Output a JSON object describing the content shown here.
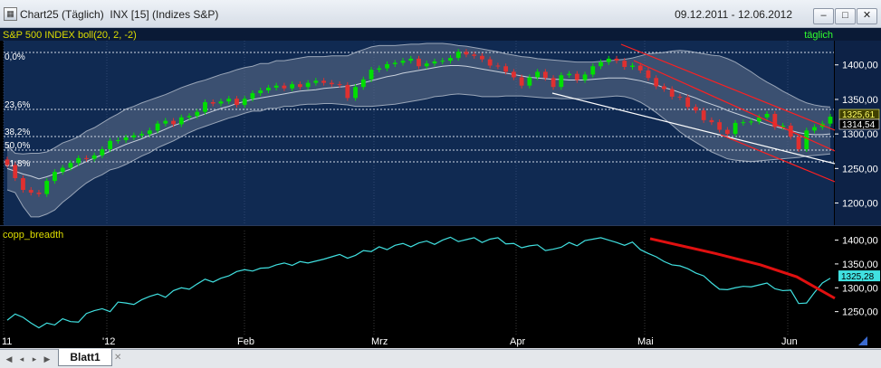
{
  "window": {
    "title": "Chart25 (Täglich)  INX [15] (Indizes S&P)",
    "date_range": "09.12.2011 - 12.06.2012",
    "buttons": {
      "minimize": "–",
      "maximize": "□",
      "close": "✕"
    }
  },
  "upper_panel": {
    "label": "S&P 500 INDEX boll(20, 2, -2)",
    "period_label": "täglich",
    "fib_levels": [
      "0,0%",
      "23,6%",
      "38,2%",
      "50,0%",
      "61,8%"
    ],
    "price_labels": [
      "1325,61",
      "1314,54"
    ],
    "price_label_colors": [
      "#ffff66",
      "#ffffff"
    ],
    "colors": {
      "up": "#00e000",
      "down": "#e03030",
      "band": "#9aa6b8",
      "channel": "#ff2020",
      "trend": "#ffffff",
      "label": "#dddd00"
    }
  },
  "lower_panel": {
    "label": "copp_breadth",
    "value_label": "1325,28",
    "colors": {
      "line": "#40e0e0",
      "trend": "#e01010",
      "label": "#dddd00"
    }
  },
  "chart_data": [
    {
      "type": "candlestick",
      "title": "S&P 500 INDEX boll(20, 2, -2)",
      "yticks": [
        1200,
        1250,
        1300,
        1350,
        1400
      ],
      "ytick_labels": [
        "1200,00",
        "1250,00",
        "1300,00",
        "1350,00",
        "1400,00"
      ],
      "ylim": [
        1168,
        1435
      ],
      "xlabels": [
        "11",
        "'12",
        "Feb",
        "Mrz",
        "Apr",
        "Mai",
        "Jun"
      ],
      "close": [
        1255,
        1236,
        1219,
        1215,
        1213,
        1232,
        1245,
        1251,
        1258,
        1265,
        1264,
        1269,
        1278,
        1290,
        1291,
        1295,
        1298,
        1300,
        1305,
        1315,
        1319,
        1314,
        1324,
        1326,
        1332,
        1346,
        1344,
        1347,
        1351,
        1342,
        1351,
        1359,
        1363,
        1367,
        1370,
        1366,
        1372,
        1368,
        1374,
        1377,
        1374,
        1372,
        1371,
        1352,
        1368,
        1379,
        1393,
        1395,
        1401,
        1403,
        1406,
        1409,
        1398,
        1402,
        1405,
        1406,
        1410,
        1419,
        1415,
        1413,
        1408,
        1399,
        1398,
        1390,
        1382,
        1370,
        1382,
        1390,
        1381,
        1368,
        1385,
        1387,
        1378,
        1386,
        1398,
        1404,
        1409,
        1406,
        1397,
        1399,
        1392,
        1381,
        1369,
        1365,
        1354,
        1353,
        1339,
        1334,
        1320,
        1317,
        1306,
        1300,
        1316,
        1317,
        1318,
        1324,
        1329,
        1310,
        1312,
        1296,
        1278,
        1305,
        1310,
        1315,
        1325
      ],
      "upper_band": [
        1283,
        1272,
        1271,
        1272,
        1272,
        1274,
        1280,
        1287,
        1291,
        1296,
        1304,
        1309,
        1316,
        1323,
        1329,
        1336,
        1340,
        1345,
        1349,
        1353,
        1357,
        1362,
        1367,
        1371,
        1375,
        1378,
        1382,
        1386,
        1389,
        1393,
        1396,
        1398,
        1402,
        1402,
        1406,
        1406,
        1408,
        1410,
        1412,
        1412,
        1412,
        1413,
        1413,
        1413,
        1418,
        1422,
        1426,
        1428,
        1428,
        1428,
        1429,
        1430,
        1430,
        1431,
        1431,
        1431,
        1430,
        1428,
        1427,
        1425,
        1423,
        1421,
        1419,
        1416,
        1414,
        1412,
        1411,
        1409,
        1408,
        1407,
        1406,
        1405,
        1404,
        1404,
        1404,
        1405,
        1406,
        1407,
        1408,
        1410,
        1413,
        1416,
        1417,
        1418,
        1420,
        1421,
        1420,
        1418,
        1416,
        1414,
        1413,
        1409,
        1404,
        1397,
        1390,
        1382,
        1375,
        1369,
        1362,
        1356,
        1350,
        1345,
        1342,
        1340,
        1339
      ],
      "middle_band": [
        1250,
        1246,
        1242,
        1239,
        1235,
        1238,
        1242,
        1245,
        1249,
        1255,
        1260,
        1265,
        1270,
        1275,
        1280,
        1285,
        1289,
        1293,
        1298,
        1302,
        1307,
        1312,
        1316,
        1321,
        1325,
        1329,
        1333,
        1337,
        1340,
        1344,
        1347,
        1350,
        1352,
        1354,
        1356,
        1358,
        1360,
        1362,
        1363,
        1364,
        1366,
        1367,
        1368,
        1369,
        1371,
        1374,
        1377,
        1380,
        1383,
        1385,
        1388,
        1390,
        1392,
        1394,
        1396,
        1398,
        1399,
        1399,
        1398,
        1396,
        1394,
        1392,
        1390,
        1388,
        1386,
        1384,
        1382,
        1381,
        1380,
        1379,
        1379,
        1378,
        1378,
        1378,
        1379,
        1380,
        1381,
        1381,
        1381,
        1379,
        1377,
        1374,
        1371,
        1367,
        1364,
        1360,
        1356,
        1352,
        1347,
        1343,
        1339,
        1334,
        1330,
        1326,
        1322,
        1318,
        1314,
        1311,
        1308,
        1305,
        1302,
        1300,
        1299,
        1299,
        1300
      ],
      "lower_band": [
        1219,
        1215,
        1195,
        1180,
        1180,
        1184,
        1190,
        1201,
        1210,
        1220,
        1229,
        1236,
        1241,
        1248,
        1251,
        1256,
        1262,
        1268,
        1273,
        1280,
        1285,
        1290,
        1296,
        1302,
        1307,
        1311,
        1315,
        1319,
        1323,
        1326,
        1330,
        1333,
        1333,
        1337,
        1337,
        1340,
        1340,
        1342,
        1343,
        1343,
        1344,
        1344,
        1343,
        1342,
        1340,
        1340,
        1340,
        1341,
        1342,
        1343,
        1345,
        1347,
        1349,
        1351,
        1354,
        1355,
        1357,
        1358,
        1357,
        1356,
        1354,
        1354,
        1354,
        1355,
        1355,
        1355,
        1354,
        1353,
        1352,
        1352,
        1351,
        1351,
        1351,
        1351,
        1352,
        1353,
        1354,
        1355,
        1354,
        1351,
        1346,
        1339,
        1331,
        1322,
        1313,
        1303,
        1295,
        1288,
        1281,
        1274,
        1269,
        1264,
        1262,
        1261,
        1260,
        1261,
        1262,
        1263,
        1264,
        1265,
        1266,
        1268,
        1269,
        1270,
        1271
      ]
    },
    {
      "type": "line",
      "title": "copp_breadth",
      "yticks": [
        1250,
        1300,
        1350,
        1400
      ],
      "ytick_labels": [
        "1250,00",
        "1300,00",
        "1350,00",
        "1400,00"
      ],
      "ylim": [
        1200,
        1420
      ],
      "values": [
        1232,
        1245,
        1238,
        1226,
        1216,
        1226,
        1222,
        1235,
        1229,
        1228,
        1246,
        1252,
        1256,
        1250,
        1270,
        1268,
        1265,
        1275,
        1282,
        1287,
        1280,
        1294,
        1300,
        1297,
        1308,
        1318,
        1312,
        1320,
        1325,
        1334,
        1338,
        1335,
        1341,
        1342,
        1348,
        1352,
        1347,
        1355,
        1352,
        1356,
        1360,
        1365,
        1370,
        1362,
        1368,
        1378,
        1376,
        1386,
        1380,
        1389,
        1393,
        1386,
        1394,
        1398,
        1391,
        1400,
        1406,
        1397,
        1401,
        1405,
        1395,
        1402,
        1405,
        1392,
        1393,
        1384,
        1388,
        1390,
        1378,
        1381,
        1385,
        1395,
        1388,
        1399,
        1402,
        1405,
        1400,
        1395,
        1389,
        1396,
        1380,
        1372,
        1365,
        1355,
        1348,
        1346,
        1340,
        1331,
        1325,
        1310,
        1297,
        1296,
        1300,
        1303,
        1302,
        1306,
        1310,
        1298,
        1294,
        1295,
        1267,
        1268,
        1290,
        1310,
        1320
      ]
    }
  ],
  "tabs": {
    "sheet": "Blatt1",
    "close": "✕"
  }
}
